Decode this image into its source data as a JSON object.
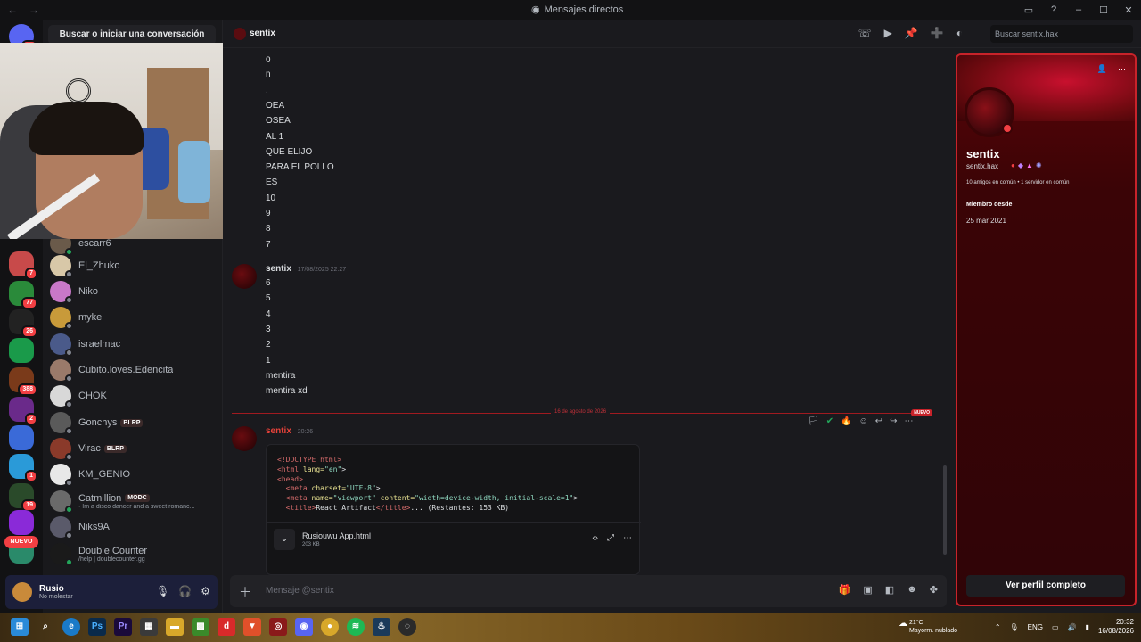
{
  "window": {
    "title": "Mensajes directos"
  },
  "servers": [
    {
      "badge": "41",
      "color": "#5865f2"
    },
    {
      "badge": "7",
      "color": "#c84a4a"
    },
    {
      "badge": "77",
      "color": "#2a8a3a"
    },
    {
      "badge": "26",
      "color": "#222"
    },
    {
      "badge": "",
      "color": "#1a9a4a"
    },
    {
      "badge": "388",
      "color": "#7a3a1a"
    },
    {
      "badge": "2",
      "color": "#6a2a8a"
    },
    {
      "badge": "",
      "color": "#3a6ad8"
    },
    {
      "badge": "1",
      "color": "#2a9ad8"
    },
    {
      "badge": "19",
      "color": "#2a4a2a"
    },
    {
      "badge": "",
      "color": "#8a2ad8"
    },
    {
      "badge": "",
      "color": "#2a8a6a"
    }
  ],
  "nuevo_pill": "NUEVO",
  "dm_search": "Buscar o iniciar una conversación",
  "dm_list": [
    {
      "name": "escarr6",
      "color": "#6a5a4a",
      "status": "#23a55a"
    },
    {
      "name": "El_Zhuko",
      "color": "#d8c8a8",
      "status": "#80848e"
    },
    {
      "name": "Niko",
      "color": "#c878c8",
      "status": "#80848e"
    },
    {
      "name": "myke",
      "color": "#c89a3a",
      "status": "#80848e"
    },
    {
      "name": "israelmac",
      "color": "#4a5a8a",
      "status": "#80848e"
    },
    {
      "name": "Cubito.loves.Edencita",
      "color": "#9a7a6a",
      "status": "#80848e"
    },
    {
      "name": "CHOK",
      "color": "#d8d8d8",
      "status": "#80848e"
    },
    {
      "name": "Gonchys",
      "color": "#5a5a5a",
      "status": "#80848e",
      "tag": "BLRP"
    },
    {
      "name": "Virac",
      "color": "#8a3a2a",
      "status": "#80848e",
      "tag": "BLRP"
    },
    {
      "name": "KM_GENIO",
      "color": "#e8e8e8",
      "status": "#80848e"
    },
    {
      "name": "Catmillion",
      "color": "#6a6a6a",
      "status": "#23a55a",
      "tag": "MODC",
      "sub": "· Im a disco dancer and a sweet romanc..."
    },
    {
      "name": "Niks9A",
      "color": "#5a5a6a",
      "status": "#80848e"
    },
    {
      "name": "Double Counter",
      "color": "#1a1a1a",
      "status": "#23a55a",
      "sub": "/help | doublecounter.gg"
    }
  ],
  "user": {
    "name": "Rusio",
    "status": "No molestar"
  },
  "channel": {
    "name": "sentix",
    "search_placeholder": "Buscar sentix.hax"
  },
  "messages_top": [
    "o",
    "n",
    ".",
    "OEA",
    "OSEA",
    "AL 1",
    "QUE ELIJO",
    "PARA EL POLLO",
    "ES",
    "10",
    "9",
    "8",
    "7"
  ],
  "message2": {
    "author": "sentix",
    "time": "17/08/2025 22:27",
    "lines": [
      "6",
      "5",
      "4",
      "3",
      "2",
      "1",
      "mentira",
      "mentira xd"
    ]
  },
  "divider": {
    "date": "16 de agosto de 2026",
    "new": "NUEVO"
  },
  "message3": {
    "author": "sentix",
    "time": "20:26",
    "code": {
      "l1": "<!DOCTYPE html>",
      "l2_tag": "<html",
      "l2_attr": " lang=",
      "l2_val": "\"en\"",
      "l2_end": ">",
      "l3": "<head>",
      "l4_tag": "  <meta",
      "l4_attr": " charset=",
      "l4_val": "\"UTF-8\"",
      "l4_end": ">",
      "l5_tag": "  <meta",
      "l5_attr1": " name=",
      "l5_val1": "\"viewport\"",
      "l5_attr2": " content=",
      "l5_val2": "\"width=device-width, initial-scale=1\"",
      "l5_end": ">",
      "l6_open": "  <title>",
      "l6_text": "React Artifact",
      "l6_close": "</title>",
      "l6_rest": "... (Restantes: 153 KB)"
    },
    "file": {
      "name": "Rusiouwu App.html",
      "size": "203 KB"
    }
  },
  "composer": {
    "placeholder": "Mensaje @sentix"
  },
  "profile": {
    "display_name": "sentix",
    "username": "sentix.hax",
    "mutual": "10 amigos en común • 1 servidor en común",
    "since_label": "Miembro desde",
    "since_date": "25 mar 2021",
    "full_button": "Ver perfil completo"
  },
  "taskbar": {
    "weather_temp": "21°C",
    "weather_desc": "Mayorm. nublado",
    "lang": "ENG",
    "time": "20:32",
    "date": "16/08/2026"
  },
  "colors": {
    "accent": "#c8232a",
    "bg": "#1a1a1e",
    "brand": "#5865f2"
  }
}
